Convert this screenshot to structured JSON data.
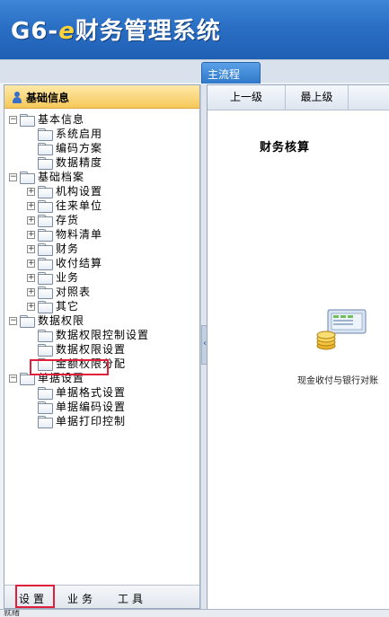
{
  "app": {
    "title_prefix": "G6-",
    "title_e": "e",
    "title_rest": "财务管理系统"
  },
  "tabs": [
    {
      "label": "主流程",
      "active": true
    }
  ],
  "left_panel": {
    "title": "基础信息",
    "tree": [
      {
        "label": "基本信息",
        "level": 0,
        "toggle": "−"
      },
      {
        "label": "系统启用",
        "level": 1
      },
      {
        "label": "编码方案",
        "level": 1
      },
      {
        "label": "数据精度",
        "level": 1
      },
      {
        "label": "基础档案",
        "level": 0,
        "toggle": "−"
      },
      {
        "label": "机构设置",
        "level": 1,
        "toggle": "+"
      },
      {
        "label": "往来单位",
        "level": 1,
        "toggle": "+"
      },
      {
        "label": "存货",
        "level": 1,
        "toggle": "+"
      },
      {
        "label": "物料清单",
        "level": 1,
        "toggle": "+"
      },
      {
        "label": "财务",
        "level": 1,
        "toggle": "+"
      },
      {
        "label": "收付结算",
        "level": 1,
        "toggle": "+"
      },
      {
        "label": "业务",
        "level": 1,
        "toggle": "+"
      },
      {
        "label": "对照表",
        "level": 1,
        "toggle": "+"
      },
      {
        "label": "其它",
        "level": 1,
        "toggle": "+"
      },
      {
        "label": "数据权限",
        "level": 0,
        "toggle": "−"
      },
      {
        "label": "数据权限控制设置",
        "level": 1
      },
      {
        "label": "数据权限设置",
        "level": 1
      },
      {
        "label": "金额权限分配",
        "level": 1
      },
      {
        "label": "单据设置",
        "level": 0,
        "toggle": "−"
      },
      {
        "label": "单据格式设置",
        "level": 1
      },
      {
        "label": "单据编码设置",
        "level": 1
      },
      {
        "label": "单据打印控制",
        "level": 1
      }
    ],
    "bottom_tabs": [
      "设置",
      "业务",
      "工具"
    ]
  },
  "right_panel": {
    "toolbar": {
      "up_label": "上一级",
      "top_label": "最上级"
    },
    "section_title": "财务核算",
    "cash_caption": "现金收付与银行对账"
  },
  "status_text": "就绪",
  "colors": {
    "banner": "#2a6fc4",
    "highlight": "#e0203a",
    "accent_tab": "#3a82d0"
  }
}
